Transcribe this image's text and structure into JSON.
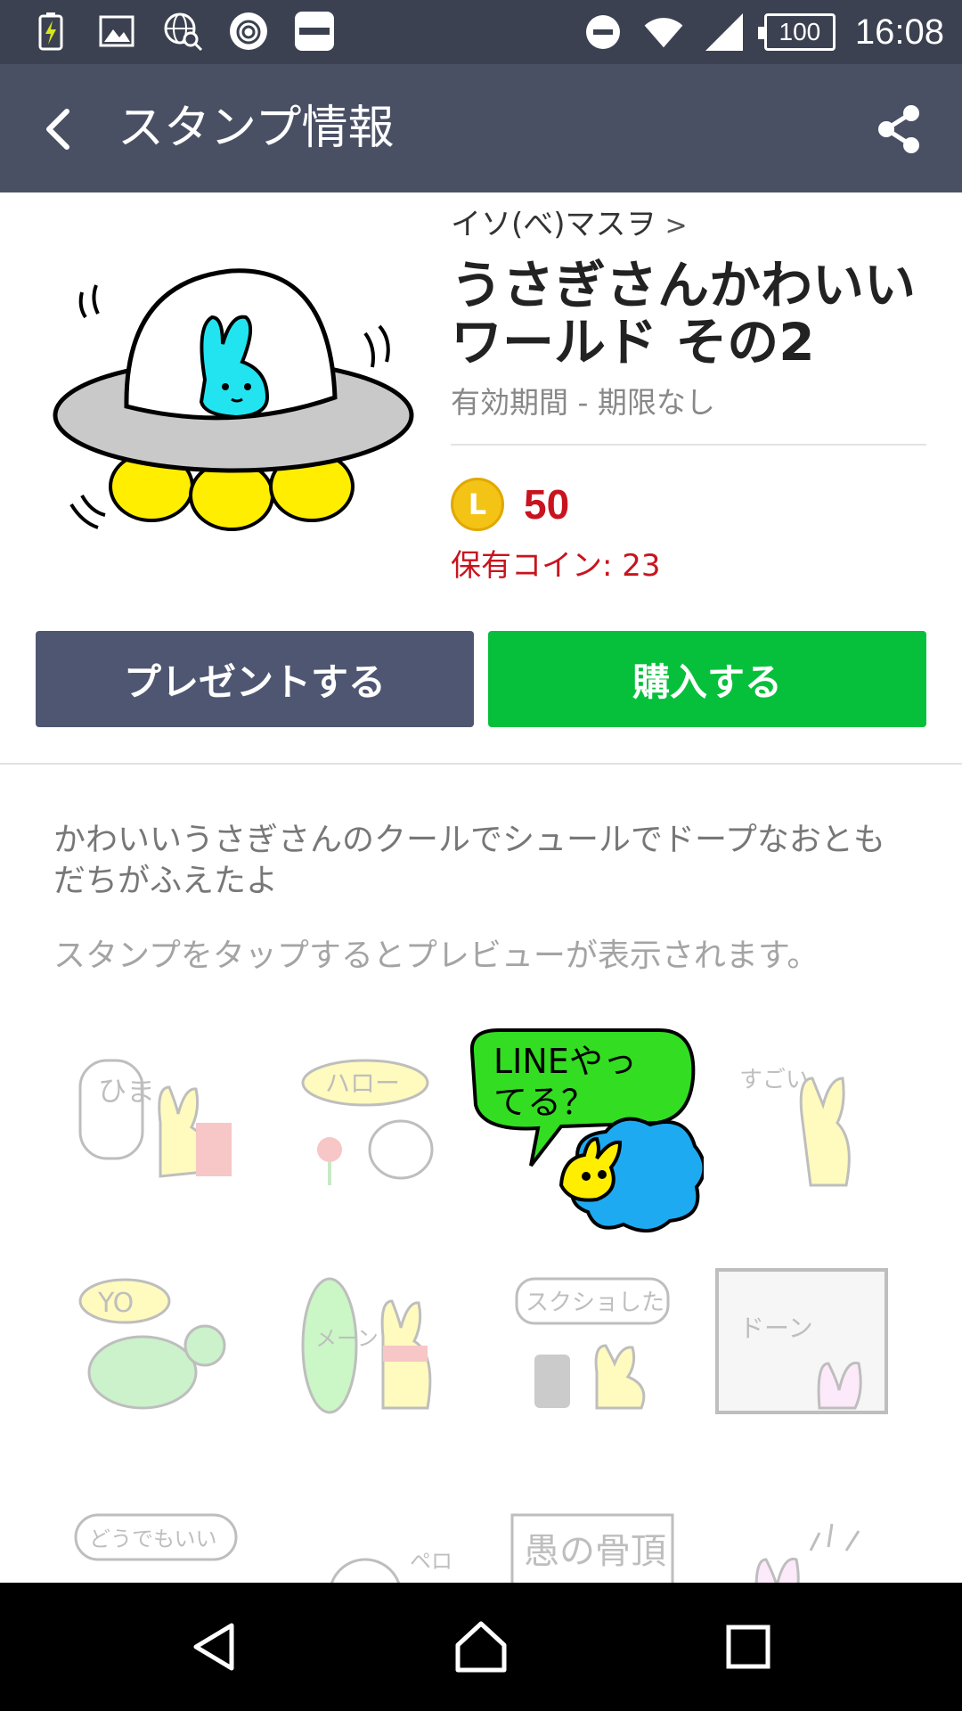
{
  "status_bar": {
    "time": "16:08",
    "battery_level": "100",
    "icons": [
      "battery-charging-icon",
      "image-icon",
      "globe-search-icon",
      "camera-icon",
      "app-icon",
      "do-not-disturb-icon",
      "wifi-icon",
      "signal-icon"
    ]
  },
  "app_bar": {
    "title": "スタンプ情報",
    "back_icon": "back-arrow-icon",
    "share_icon": "share-icon"
  },
  "product": {
    "creator": "イソ(べ)マスヲ",
    "creator_chevron": ">",
    "name": "うさぎさんかわいいワールド その2",
    "validity": "有効期間 - 期限なし",
    "coin_symbol": "L",
    "price": "50",
    "owned_coins": "保有コイン: 23"
  },
  "buttons": {
    "gift": "プレゼントする",
    "buy": "購入する"
  },
  "description": "かわいいうさぎさんのクールでシュールでドープなおともだちがふえたよ",
  "preview_hint": "スタンプをタップするとプレビューが表示されます。",
  "stickers": {
    "highlighted_text_line1": "LINEやっ",
    "highlighted_text_line2": "てる？",
    "cells": [
      {
        "text": "ひま",
        "faded": true
      },
      {
        "text": "ハロー",
        "faded": true
      },
      {
        "text": "LINEやってる？",
        "faded": false
      },
      {
        "text": "すごい",
        "faded": true
      },
      {
        "text": "YO",
        "faded": true
      },
      {
        "text": "メーン",
        "faded": true
      },
      {
        "text": "スクショした",
        "faded": true
      },
      {
        "text": "ドーン",
        "faded": true
      },
      {
        "text": "どうでもいい",
        "faded": true
      },
      {
        "text": "ペロ",
        "faded": true
      },
      {
        "text": "愚の骨頂",
        "faded": true
      },
      {
        "text": "",
        "faded": true
      }
    ]
  },
  "colors": {
    "status_bar": "#3b4150",
    "app_bar": "#4a5064",
    "gift_button": "#4e5672",
    "buy_button": "#06c03c",
    "price_red": "#c8141e",
    "coin_gold": "#f3c316"
  },
  "nav_bar": {
    "back": "nav-back-icon",
    "home": "nav-home-icon",
    "recents": "nav-recents-icon"
  }
}
